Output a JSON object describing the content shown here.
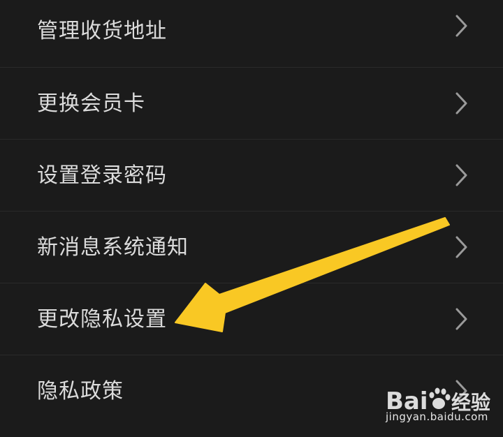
{
  "settings_list": {
    "items": [
      {
        "label": "管理收货地址"
      },
      {
        "label": "更换会员卡"
      },
      {
        "label": "设置登录密码"
      },
      {
        "label": "新消息系统通知"
      },
      {
        "label": "更改隐私设置"
      },
      {
        "label": "隐私政策"
      }
    ]
  },
  "annotation": {
    "arrow_color": "#f9c824",
    "target_item": "更改隐私设置"
  },
  "watermark": {
    "brand": "Bai度经验",
    "url": "jingyan.baidu.com"
  },
  "colors": {
    "background": "#1b1b1b",
    "text": "#dcdcdc",
    "chevron": "#9a9a9a",
    "divider": "#2a2a2a"
  }
}
